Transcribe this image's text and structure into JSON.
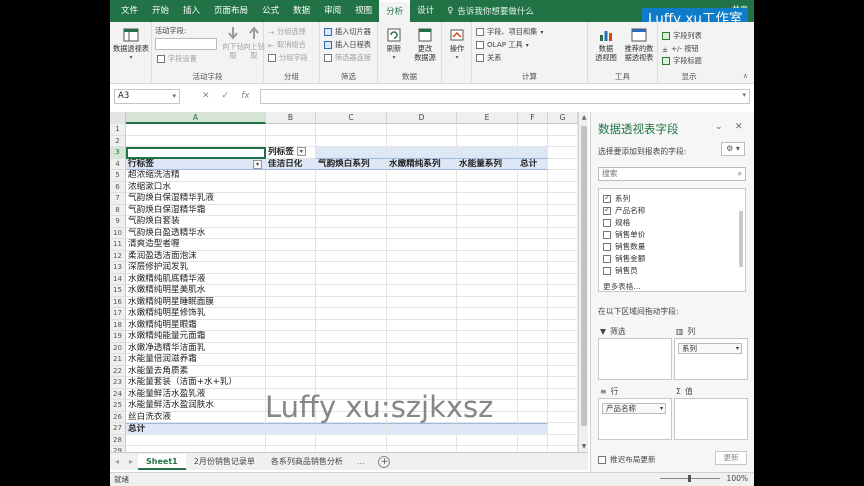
{
  "tabs": [
    "文件",
    "开始",
    "插入",
    "页面布局",
    "公式",
    "数据",
    "审阅",
    "视图",
    "分析",
    "设计"
  ],
  "active_tab": "分析",
  "tell_me": "告诉我你想要做什么",
  "share": "共享",
  "watermark_top": "Luffy xu工作室",
  "watermark_mid": "Luffy xu:szjkxsz",
  "ribbon": {
    "pivot_btn": "数据透视表",
    "active_field_label": "活动字段:",
    "field_settings": "字段设置",
    "drill_down": "向下钻取",
    "drill_up": "向上钻",
    "drill_up2": "取",
    "group_active_field": "活动字段",
    "group_selection": "分组选择",
    "ungroup": "取消组合",
    "group_field": "分组字段",
    "group_group": "分组",
    "insert_slicer": "插入切片器",
    "insert_timeline": "插入日程表",
    "filter_connections": "筛选器连接",
    "group_filter": "筛选",
    "refresh": "刷新",
    "change_source": "更改",
    "change_source2": "数据源",
    "group_data": "数据",
    "actions": "操作",
    "fields_items": "字段、项目和集",
    "olap": "OLAP 工具",
    "relationships": "关系",
    "group_calc": "计算",
    "pivotchart": "数据",
    "pivotchart2": "透视图",
    "recommended": "推荐的数",
    "recommended2": "据透视表",
    "group_tools": "工具",
    "field_list": "字段列表",
    "buttons": "+/- 按钮",
    "field_headers": "字段标题",
    "group_show": "显示"
  },
  "namebox": "A3",
  "columns": [
    "A",
    "B",
    "C",
    "D",
    "E",
    "F",
    "G"
  ],
  "pivot": {
    "col_label_header": "列标签",
    "row_label_header": "行标签",
    "col_items": [
      "佳洁日化",
      "气韵焕白系列",
      "水嫩精纯系列",
      "水能量系列",
      "总计"
    ],
    "rows": [
      "超浓缩洗洁精",
      "浓缩漱口水",
      "气韵焕白保湿精华乳液",
      "气韵焕白保湿精华霜",
      "气韵焕白套装",
      "气韵焕白盈透精华水",
      "清爽造型者喱",
      "柔润盈透洁面泡沫",
      "深层修护润发乳",
      "水嫩精纯肌底精华液",
      "水嫩精纯明星美肌水",
      "水嫩精纯明星睡眠面膜",
      "水嫩精纯明星修饰乳",
      "水嫩精纯明星眼霜",
      "水嫩精纯能量元面霜",
      "水嫩净透精华洁面乳",
      "水能量倍润滋养霜",
      "水能量去角质素",
      "水能量套装（洁面+水+乳）",
      "水能量鲜活水盈乳液",
      "水能量鲜活水盈润肤水",
      "丝白洗衣液"
    ],
    "total_label": "总计"
  },
  "sheets": [
    "Sheet1",
    "2月份销售记录单",
    "各系列商品销售分析"
  ],
  "more_sheets": "...",
  "status": {
    "ready": "就绪",
    "zoom": "100%"
  },
  "pane": {
    "title": "数据透视表字段",
    "subtitle": "选择要添加到报表的字段:",
    "search_placeholder": "搜索",
    "fields": [
      {
        "name": "系列",
        "checked": true
      },
      {
        "name": "产品名称",
        "checked": true
      },
      {
        "name": "规格",
        "checked": false
      },
      {
        "name": "销售单价",
        "checked": false
      },
      {
        "name": "销售数量",
        "checked": false
      },
      {
        "name": "销售金额",
        "checked": false
      },
      {
        "name": "销售员",
        "checked": false
      }
    ],
    "more_tables": "更多表格...",
    "drag_label": "在以下区域间拖动字段:",
    "filter_area": "筛选",
    "columns_area": "列",
    "columns_chip": "系列",
    "rows_area": "行",
    "rows_chip": "产品名称",
    "values_area": "值",
    "defer": "推迟布局更新",
    "update": "更新"
  },
  "colors": {
    "excel_green": "#217346",
    "accent_blue": "#0f7cc9",
    "band": "#dde7f5"
  }
}
